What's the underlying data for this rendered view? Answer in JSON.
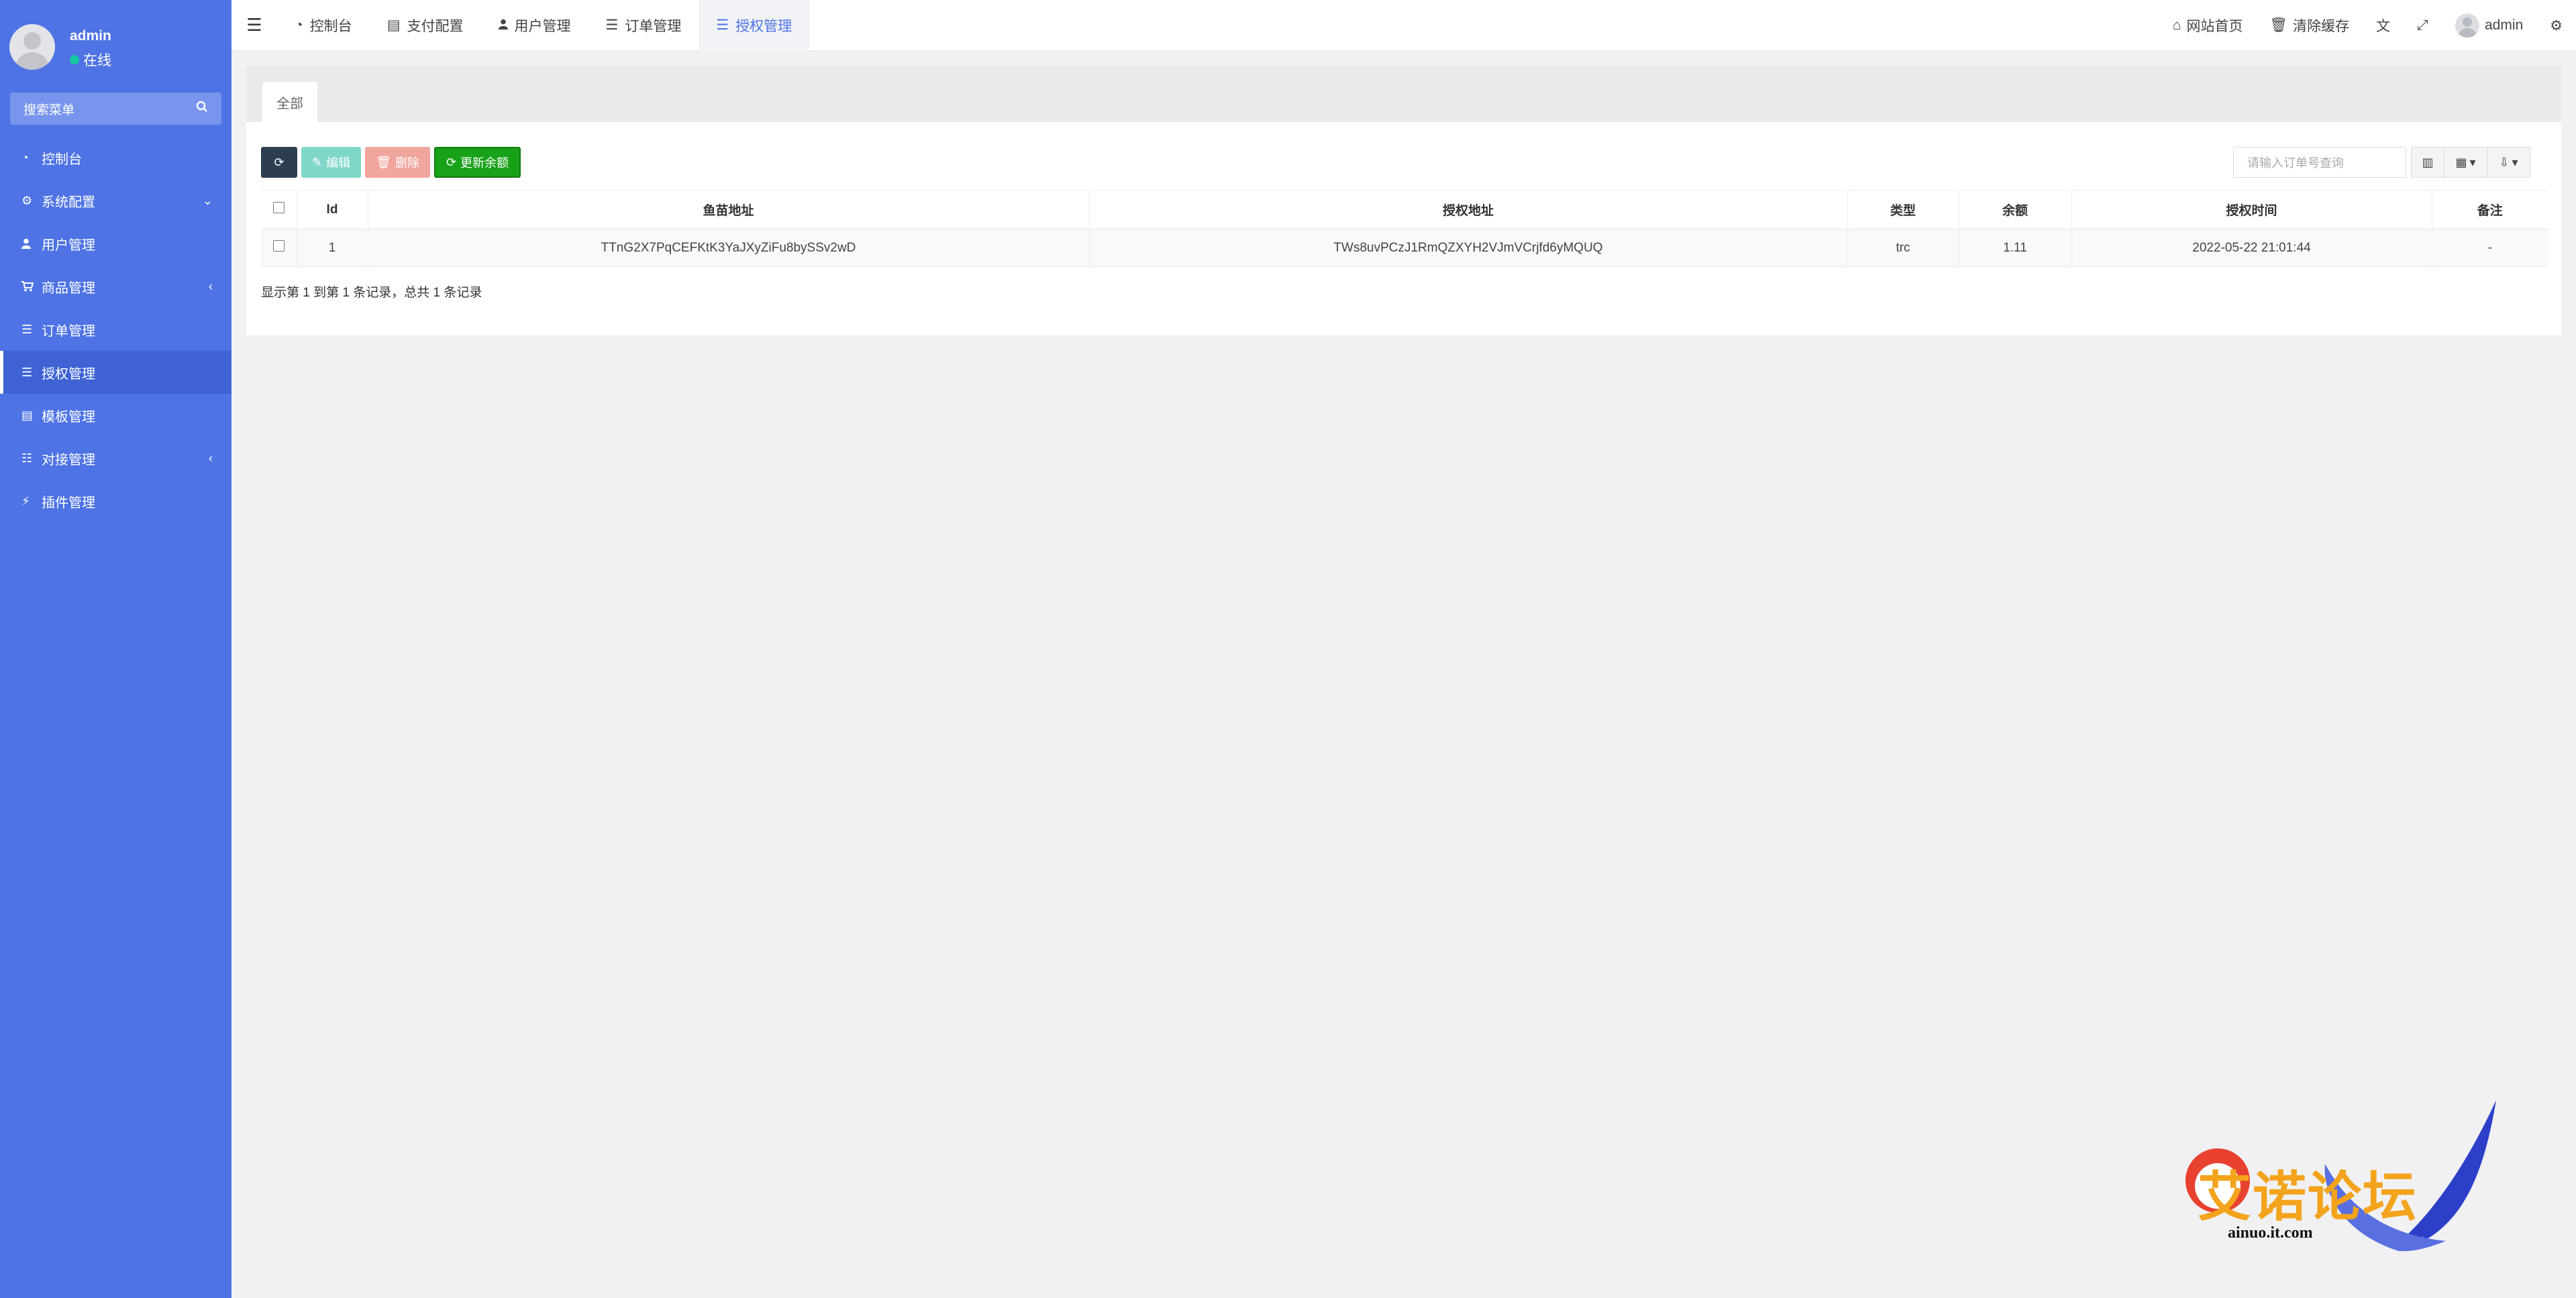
{
  "sidebar": {
    "user": {
      "name": "admin",
      "status": "在线"
    },
    "search_placeholder": "搜索菜单",
    "items": [
      {
        "label": "控制台",
        "icon": "dashboard-icon"
      },
      {
        "label": "系统配置",
        "icon": "gear-icon"
      },
      {
        "label": "用户管理",
        "icon": "user-icon"
      },
      {
        "label": "商品管理",
        "icon": "cart-icon"
      },
      {
        "label": "订单管理",
        "icon": "list-icon"
      },
      {
        "label": "授权管理",
        "icon": "list-icon"
      },
      {
        "label": "模板管理",
        "icon": "table-icon"
      },
      {
        "label": "对接管理",
        "icon": "sliders-icon"
      },
      {
        "label": "插件管理",
        "icon": "plug-icon"
      }
    ]
  },
  "topbar": {
    "tabs": [
      {
        "label": "控制台",
        "icon": "dashboard-icon"
      },
      {
        "label": "支付配置",
        "icon": "table-icon"
      },
      {
        "label": "用户管理",
        "icon": "user-icon"
      },
      {
        "label": "订单管理",
        "icon": "list-icon"
      },
      {
        "label": "授权管理",
        "icon": "list-icon"
      }
    ],
    "right": {
      "home_label": "网站首页",
      "clear_cache_label": "清除缓存",
      "user_name": "admin"
    }
  },
  "panel": {
    "tab_label": "全部",
    "toolbar": {
      "edit_label": "编辑",
      "delete_label": "删除",
      "update_label": "更新余额"
    },
    "search_placeholder": "请输入订单号查询",
    "table": {
      "headers": [
        "Id",
        "鱼苗地址",
        "授权地址",
        "类型",
        "余额",
        "授权时间",
        "备注"
      ],
      "rows": [
        [
          "1",
          "TTnG2X7PqCEFKtK3YaJXyZiFu8bySSv2wD",
          "TWs8uvPCzJ1RmQZXYH2VJmVCrjfd6yMQUQ",
          "trc",
          "1.11",
          "2022-05-22 21:01:44",
          "-"
        ]
      ]
    },
    "page_info": "显示第 1 到第 1 条记录，总共 1 条记录"
  },
  "watermark": {
    "logo_text": "艾诺论坛",
    "url": "ainuo.it.com"
  },
  "colors": {
    "sidebar": "#4e73e5",
    "accent": "#4e73e5",
    "success": "#18a218",
    "danger": "#f0a59d",
    "info": "#7fd7c7"
  }
}
